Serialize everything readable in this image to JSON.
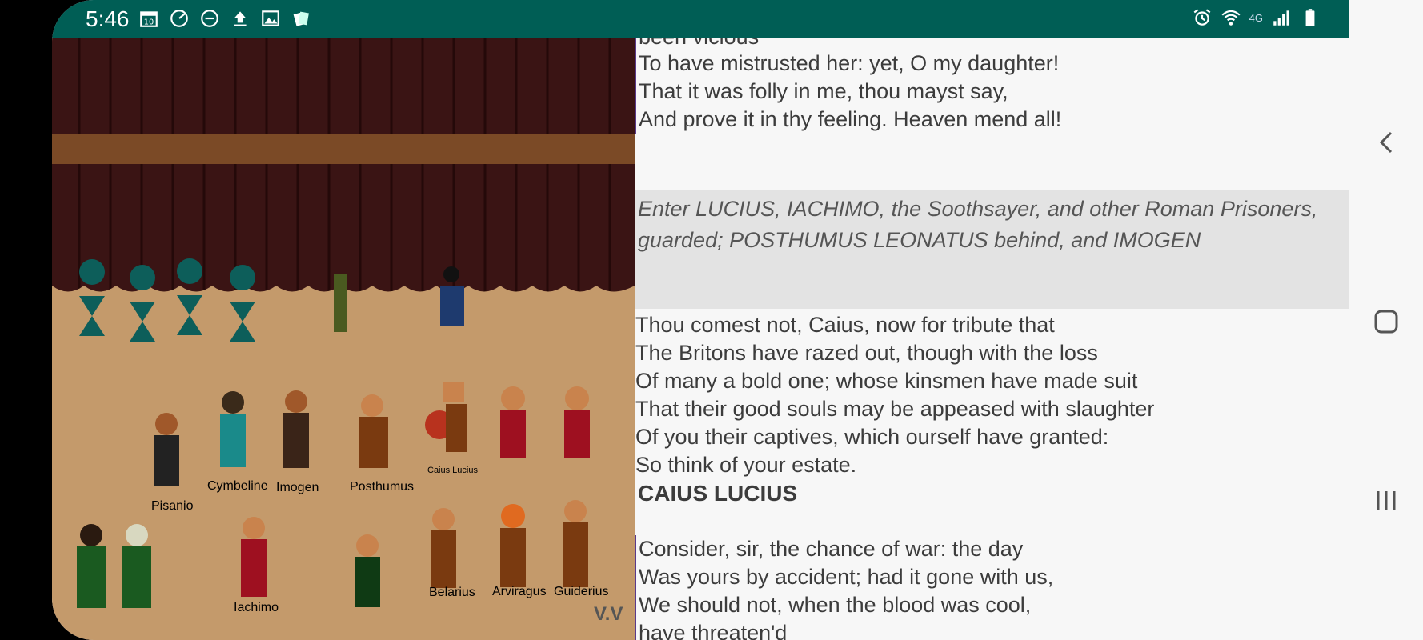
{
  "status_bar": {
    "time": "5:46",
    "left_icons": [
      "calendar-icon",
      "clock-icon",
      "do-not-disturb-icon",
      "upload-icon",
      "image-icon",
      "cards-icon"
    ],
    "right_icons": [
      "alarm-icon",
      "wifi-icon",
      "4g-icon",
      "signal-icon",
      "battery-icon"
    ],
    "network_label": "4G"
  },
  "stage": {
    "characters": [
      "Pisanio",
      "Cymbeline",
      "Imogen",
      "Posthumus",
      "Caius Lucius",
      "Iachimo",
      "Belarius",
      "Arviragus",
      "Guiderius"
    ],
    "corner_label": "V.V"
  },
  "text": {
    "top_lines": [
      "been vicious",
      "To have mistrusted her: yet, O my daughter!",
      "That it was folly in me, thou mayst say,",
      "And prove it in thy feeling. Heaven mend all!"
    ],
    "stage_direction": "Enter LUCIUS, IACHIMO, the Soothsayer, and other Roman Prisoners, guarded; POSTHUMUS LEONATUS behind, and IMOGEN",
    "middle_lines": [
      "Thou comest not, Caius, now for tribute that",
      "The Britons have razed out, though with the loss",
      "Of many a bold one; whose kinsmen have made suit",
      "That their good souls may be appeased with slaughter",
      "Of you their captives, which ourself have granted:",
      "So think of your estate."
    ],
    "speaker": "CAIUS LUCIUS",
    "bottom_lines": [
      "Consider, sir, the chance of war: the day",
      "Was yours by accident; had it gone with us,",
      "We should not, when the blood was cool,",
      "have threaten'd"
    ]
  },
  "navigation": {
    "buttons": [
      "back-icon",
      "home-icon",
      "recents-icon"
    ]
  },
  "colors": {
    "status_bar": "#005e55",
    "curtain": "#3a1414",
    "curtain_band": "#7b4a26",
    "stage_floor": "#c49a6b",
    "stage_direction_bg": "#e3e3e3"
  }
}
